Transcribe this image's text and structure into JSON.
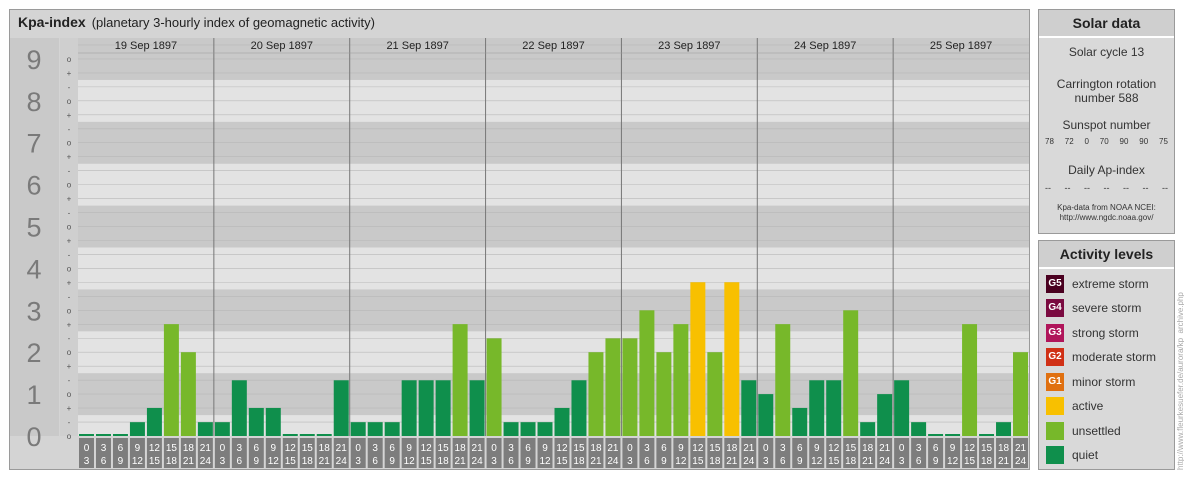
{
  "header": {
    "title": "Kpa-index",
    "subtitle": "(planetary 3-hourly index of geomagnetic activity)"
  },
  "chart_data": {
    "type": "bar",
    "y_levels": [
      "0",
      "1",
      "2",
      "3",
      "4",
      "5",
      "6",
      "7",
      "8",
      "9"
    ],
    "sub_ticks": [
      "o",
      "-",
      "+"
    ],
    "days": [
      "19 Sep 1897",
      "20 Sep 1897",
      "21 Sep 1897",
      "22 Sep 1897",
      "23 Sep 1897",
      "24 Sep 1897",
      "25 Sep 1897"
    ],
    "interval_top": [
      "0",
      "3",
      "6",
      "9",
      "12",
      "15",
      "18",
      "21"
    ],
    "interval_bottom": [
      "3",
      "6",
      "9",
      "12",
      "15",
      "18",
      "21",
      "24"
    ],
    "ylim": [
      0,
      9.33
    ],
    "values": [
      0,
      0,
      0,
      0.33,
      0.67,
      2.67,
      2,
      0.33,
      0.33,
      1.33,
      0.67,
      0.67,
      0,
      0,
      0,
      1.33,
      0.33,
      0.33,
      0.33,
      1.33,
      1.33,
      1.33,
      2.67,
      1.33,
      2.33,
      0.33,
      0.33,
      0.33,
      0.67,
      1.33,
      2,
      2.33,
      2.33,
      3,
      2,
      2.67,
      3.67,
      2,
      3.67,
      1.33,
      1,
      2.67,
      0.67,
      1.33,
      1.33,
      3,
      0.33,
      1,
      1.33,
      0.33,
      0,
      0,
      2.67,
      0,
      0.33,
      2
    ],
    "colors": {
      "quiet": "#0f8f4c",
      "unsettled": "#77b82a",
      "active": "#f8c000"
    }
  },
  "solar": {
    "title": "Solar data",
    "cycle": "Solar cycle 13",
    "carrington_1": "Carrington rotation",
    "carrington_2": "number 588",
    "sunspot_title": "Sunspot number",
    "sunspots": [
      "78",
      "72",
      "0",
      "70",
      "90",
      "90",
      "75"
    ],
    "ap_title": "Daily Ap-index",
    "ap": [
      "--",
      "--",
      "--",
      "--",
      "--",
      "--",
      "--"
    ],
    "source_1": "Kpa-data from NOAA NCEI:",
    "source_2": "http://www.ngdc.noaa.gov/"
  },
  "activity": {
    "title": "Activity levels",
    "levels": [
      {
        "code": "G5",
        "label": "extreme storm",
        "color": "#4a0020"
      },
      {
        "code": "G4",
        "label": "severe storm",
        "color": "#7a0a40"
      },
      {
        "code": "G3",
        "label": "strong storm",
        "color": "#b0155a"
      },
      {
        "code": "G2",
        "label": "moderate storm",
        "color": "#d03015"
      },
      {
        "code": "G1",
        "label": "minor storm",
        "color": "#e07010"
      },
      {
        "code": "",
        "label": "active",
        "color": "#f8c000"
      },
      {
        "code": "",
        "label": "unsettled",
        "color": "#77b82a"
      },
      {
        "code": "",
        "label": "quiet",
        "color": "#0f8f4c"
      }
    ]
  },
  "watermark": "http://www.fleurkesuefer.de/aurora/kp_archive.php"
}
